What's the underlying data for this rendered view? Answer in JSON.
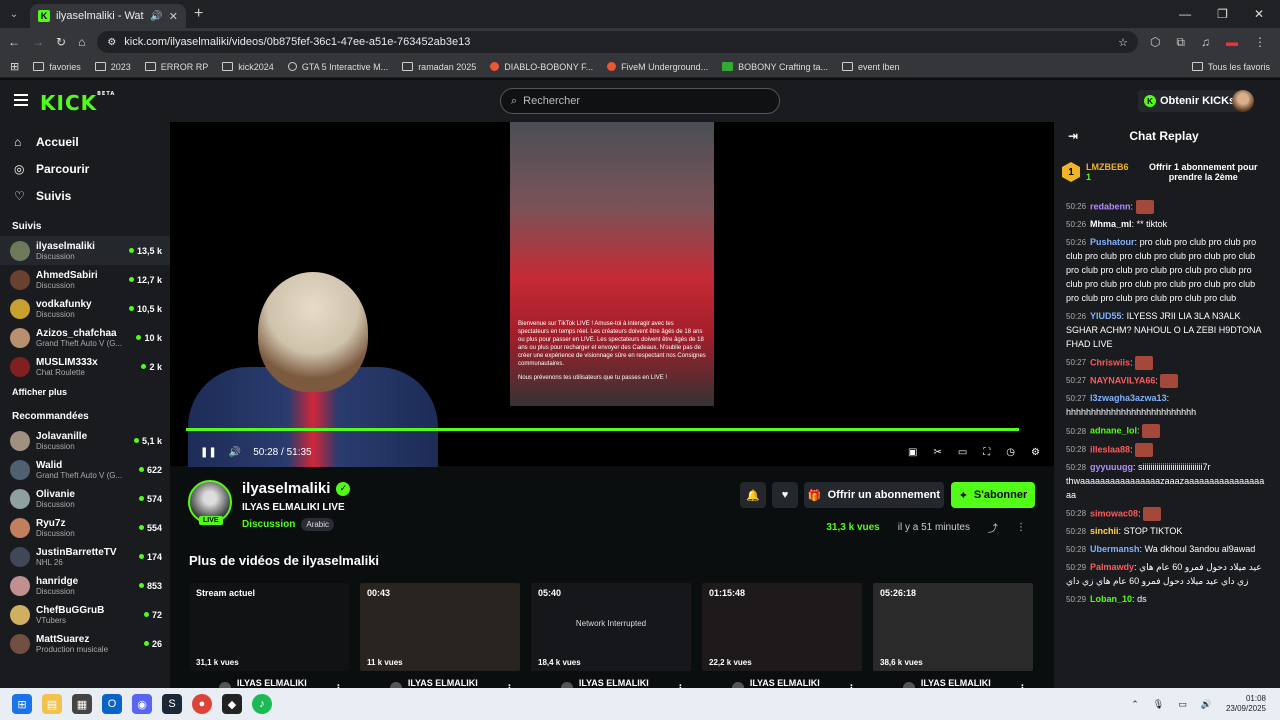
{
  "browser": {
    "tab_title": "ilyaselmaliki - Watch the V",
    "url": "kick.com/ilyaselmaliki/videos/0b875fef-36c1-47ee-a51e-763452ab3e13",
    "bookmarks": [
      "favories",
      "2023",
      "ERROR RP",
      "kick2024",
      "GTA 5 Interactive M...",
      "ramadan 2025",
      "DIABLO-BOBONY F...",
      "FiveM Underground...",
      "BOBONY Crafting ta...",
      "event lben"
    ],
    "all_bookmarks": "Tous les favoris"
  },
  "header": {
    "logo": "KICK",
    "logo_sup": "BETA",
    "search_placeholder": "Rechercher",
    "get_kicks": "Obtenir KICKs"
  },
  "sidebar": {
    "nav": [
      {
        "label": "Accueil",
        "icon": "home-icon"
      },
      {
        "label": "Parcourir",
        "icon": "compass-icon"
      },
      {
        "label": "Suivis",
        "icon": "heart-icon"
      }
    ],
    "followed_title": "Suivis",
    "followed": [
      {
        "name": "ilyaselmaliki",
        "category": "Discussion",
        "viewers": "13,5 k",
        "color": "#6b7a5a"
      },
      {
        "name": "AhmedSabiri",
        "category": "Discussion",
        "viewers": "12,7 k",
        "color": "#6a4030"
      },
      {
        "name": "vodkafunky",
        "category": "Discussion",
        "viewers": "10,5 k",
        "color": "#c8a030"
      },
      {
        "name": "Azizos_chafchaa",
        "category": "Grand Theft Auto V (G...",
        "viewers": "10 k",
        "color": "#b89070"
      },
      {
        "name": "MUSLIM333x",
        "category": "Chat Roulette",
        "viewers": "2 k",
        "color": "#802020"
      }
    ],
    "show_more": "Afficher plus",
    "recommended_title": "Recommandées",
    "recommended": [
      {
        "name": "Jolavanille",
        "category": "Discussion",
        "viewers": "5,1 k",
        "color": "#a09080"
      },
      {
        "name": "Walid",
        "category": "Grand Theft Auto V (G...",
        "viewers": "622",
        "color": "#506070"
      },
      {
        "name": "Olivanie",
        "category": "Discussion",
        "viewers": "574",
        "color": "#90a0a0"
      },
      {
        "name": "Ryu7z",
        "category": "Discussion",
        "viewers": "554",
        "color": "#c08060"
      },
      {
        "name": "JustinBarretteTV",
        "category": "NHL 26",
        "viewers": "174",
        "color": "#404858"
      },
      {
        "name": "hanridge",
        "category": "Discussion",
        "viewers": "853",
        "color": "#c09090"
      },
      {
        "name": "ChefBuGGruB",
        "category": "VTubers",
        "viewers": "72",
        "color": "#d0b060"
      },
      {
        "name": "MattSuarez",
        "category": "Production musicale",
        "viewers": "26",
        "color": "#705040"
      }
    ]
  },
  "video": {
    "time": "50:28 / 51:35",
    "progress": 0.978,
    "tiktok_text": "Bienvenue sur TikTok LIVE ! Amuse-toi à interagir avec tes spectateurs en temps réel. Les créateurs doivent être âgés de 18 ans ou plus pour passer en LIVE. Les spectateurs doivent être âgés de 18 ans ou plus pour recharger et envoyer des Cadeaux. N'oublie pas de créer une expérience de visionnage sûre en respectant nos Consignes communautaires.",
    "tiktok_notice": "Nous prévenons tes utilisateurs que tu passes en LIVE !"
  },
  "channel": {
    "name": "ilyaselmaliki",
    "live": "LIVE",
    "title": "ILYAS ELMALIKI LIVE",
    "category": "Discussion",
    "tag": "Arabic",
    "sub_button": "Offrir un abonnement",
    "subscribe_button": "S'abonner",
    "views": "31,3 k vues",
    "ago": "il y a 51 minutes"
  },
  "more_videos": {
    "title": "Plus de vidéos de ilyaselmaliki",
    "items": [
      {
        "duration": "Stream actuel",
        "views": "31,1 k vues",
        "middle": "",
        "name": "ILYAS ELMALIKI LIVE"
      },
      {
        "duration": "00:43",
        "views": "11 k vues",
        "middle": "",
        "name": "ILYAS ELMALIKI LIVE"
      },
      {
        "duration": "05:40",
        "views": "18,4 k vues",
        "middle": "Network Interrupted",
        "name": "ILYAS ELMALIKI LIVE"
      },
      {
        "duration": "01:15:48",
        "views": "22,2 k vues",
        "middle": "",
        "name": "ILYAS ELMALIKI LIVE"
      },
      {
        "duration": "05:26:18",
        "views": "38,6 k vues",
        "middle": "",
        "name": "ILYAS ELMALIKI LIVE"
      }
    ]
  },
  "chat": {
    "title": "Chat Replay",
    "pinned_user": "LMZBEB6",
    "pinned_count": "1",
    "pinned_text": "Offrir 1 abonnement pour prendre la 2ème",
    "messages": [
      {
        "time": "50:26",
        "user": "redabenn",
        "text": "",
        "color": "#b48cff"
      },
      {
        "time": "50:26",
        "user": "Mhma_ml",
        "text": "** tiktok",
        "color": "#ffffff"
      },
      {
        "time": "50:26",
        "user": "Pushatour",
        "text": "pro club pro club pro club pro club pro club pro club pro club pro club pro club pro club pro club pro club pro club pro club pro club pro club pro club pro club pro club pro club pro club pro club pro club pro club pro club",
        "color": "#7fb2ff"
      },
      {
        "time": "50:26",
        "user": "YIUD55",
        "text": "ILYESS JRII LIA 3LA N3ALK SGHAR ACHM? NAHOUL O LA ZEBI H9DTONA FHAD LIVE",
        "color": "#7fb2ff"
      },
      {
        "time": "50:27",
        "user": "Chriswiis",
        "text": "",
        "color": "#ff5a5a"
      },
      {
        "time": "50:27",
        "user": "NAYNAVILYA66",
        "text": "",
        "color": "#ff5a5a"
      },
      {
        "time": "50:27",
        "user": "l3zwagha3azwa13",
        "text": "hhhhhhhhhhhhhhhhhhhhhhhhhh",
        "color": "#7fb2ff"
      },
      {
        "time": "50:28",
        "user": "adnane_lol",
        "text": "",
        "color": "#53fc18"
      },
      {
        "time": "50:28",
        "user": "illeslaa88",
        "text": "",
        "color": "#ff5a5a"
      },
      {
        "time": "50:28",
        "user": "gyyuuugg",
        "text": "siiiiiiiiiiiiiiiiiiiiiiiiiiiiii7r thwaaaaaaaaaaaaaaaazaaazaaaaaaaaaaaaaaaaaa",
        "color": "#b48cff"
      },
      {
        "time": "50:28",
        "user": "simowac08",
        "text": "",
        "color": "#ff5a5a"
      },
      {
        "time": "50:28",
        "user": "sinchii",
        "text": "STOP TIKTOK",
        "color": "#ffd24a"
      },
      {
        "time": "50:28",
        "user": "Ubermansh",
        "text": "Wa dkhoul 3andou al9awad",
        "color": "#7fb2ff"
      },
      {
        "time": "50:29",
        "user": "Palmawdy",
        "text": "عيد ميلاد دحول فمرو 60 عام هاي زي داي عيد ميلاد دحول فمرو 60 عام هاي زي داي",
        "color": "#ff5a5a"
      },
      {
        "time": "50:29",
        "user": "Loban_10",
        "text": "ds",
        "color": "#53fc18"
      }
    ]
  },
  "taskbar": {
    "time": "01:08",
    "date": "23/09/2025"
  }
}
